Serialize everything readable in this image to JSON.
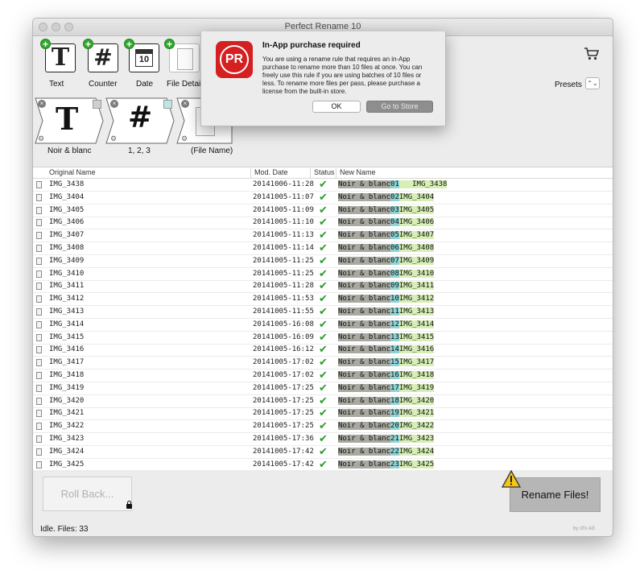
{
  "window": {
    "title": "Perfect Rename 10"
  },
  "toolbar": {
    "items": [
      {
        "label": "Text",
        "glyph": "T"
      },
      {
        "label": "Counter",
        "glyph": "#"
      },
      {
        "label": "Date",
        "glyph": "10"
      },
      {
        "label": "File Detail"
      }
    ],
    "presets_label": "Presets",
    "presets_arrows": "⌃⌄",
    "cart_icon": "cart-icon"
  },
  "rule_chips": [
    {
      "label": "Noir & blanc",
      "glyph": "T"
    },
    {
      "label": "1, 2, 3",
      "glyph": "#"
    },
    {
      "label": "(File Name)"
    }
  ],
  "table": {
    "headers": {
      "original": "Original Name",
      "date": "Mod. Date",
      "status": "Status",
      "new": "New Name"
    },
    "rows": [
      {
        "orig": "   IMG_3438",
        "date": "20141006-11:28",
        "n1": "Noir & blanc",
        "n2": "01",
        "n3": "   IMG_3438"
      },
      {
        "orig": "IMG_3404",
        "date": "20141005-11:07",
        "n1": "Noir & blanc",
        "n2": "02",
        "n3": "IMG_3404"
      },
      {
        "orig": "IMG_3405",
        "date": "20141005-11:09",
        "n1": "Noir & blanc",
        "n2": "03",
        "n3": "IMG_3405"
      },
      {
        "orig": "IMG_3406",
        "date": "20141005-11:10",
        "n1": "Noir & blanc",
        "n2": "04",
        "n3": "IMG_3406"
      },
      {
        "orig": "IMG_3407",
        "date": "20141005-11:13",
        "n1": "Noir & blanc",
        "n2": "05",
        "n3": "IMG_3407"
      },
      {
        "orig": "IMG_3408",
        "date": "20141005-11:14",
        "n1": "Noir & blanc",
        "n2": "06",
        "n3": "IMG_3408"
      },
      {
        "orig": "IMG_3409",
        "date": "20141005-11:25",
        "n1": "Noir & blanc",
        "n2": "07",
        "n3": "IMG_3409"
      },
      {
        "orig": "IMG_3410",
        "date": "20141005-11:25",
        "n1": "Noir & blanc",
        "n2": "08",
        "n3": "IMG_3410"
      },
      {
        "orig": "IMG_3411",
        "date": "20141005-11:28",
        "n1": "Noir & blanc",
        "n2": "09",
        "n3": "IMG_3411"
      },
      {
        "orig": "IMG_3412",
        "date": "20141005-11:53",
        "n1": "Noir & blanc",
        "n2": "10",
        "n3": "IMG_3412"
      },
      {
        "orig": "IMG_3413",
        "date": "20141005-11:55",
        "n1": "Noir & blanc",
        "n2": "11",
        "n3": "IMG_3413"
      },
      {
        "orig": "IMG_3414",
        "date": "20141005-16:08",
        "n1": "Noir & blanc",
        "n2": "12",
        "n3": "IMG_3414"
      },
      {
        "orig": "IMG_3415",
        "date": "20141005-16:09",
        "n1": "Noir & blanc",
        "n2": "13",
        "n3": "IMG_3415"
      },
      {
        "orig": "IMG_3416",
        "date": "20141005-16:12",
        "n1": "Noir & blanc",
        "n2": "14",
        "n3": "IMG_3416"
      },
      {
        "orig": "IMG_3417",
        "date": "20141005-17:02",
        "n1": "Noir & blanc",
        "n2": "15",
        "n3": "IMG_3417"
      },
      {
        "orig": "IMG_3418",
        "date": "20141005-17:02",
        "n1": "Noir & blanc",
        "n2": "16",
        "n3": "IMG_3418"
      },
      {
        "orig": "IMG_3419",
        "date": "20141005-17:25",
        "n1": "Noir & blanc",
        "n2": "17",
        "n3": "IMG_3419"
      },
      {
        "orig": "IMG_3420",
        "date": "20141005-17:25",
        "n1": "Noir & blanc",
        "n2": "18",
        "n3": "IMG_3420"
      },
      {
        "orig": "IMG_3421",
        "date": "20141005-17:25",
        "n1": "Noir & blanc",
        "n2": "19",
        "n3": "IMG_3421"
      },
      {
        "orig": "IMG_3422",
        "date": "20141005-17:25",
        "n1": "Noir & blanc",
        "n2": "20",
        "n3": "IMG_3422"
      },
      {
        "orig": "IMG_3423",
        "date": "20141005-17:36",
        "n1": "Noir & blanc",
        "n2": "21",
        "n3": "IMG_3423"
      },
      {
        "orig": "IMG_3424",
        "date": "20141005-17:42",
        "n1": "Noir & blanc",
        "n2": "22",
        "n3": "IMG_3424"
      },
      {
        "orig": "IMG_3425",
        "date": "20141005-17:42",
        "n1": "Noir & blanc",
        "n2": "23",
        "n3": "IMG_3425"
      }
    ]
  },
  "footer": {
    "rollback_label": "Roll Back...",
    "rename_label": "Rename Files!",
    "status_text": "Idle. Files: 33",
    "credit": "by cf/x AG"
  },
  "dialog": {
    "title": "In-App purchase required",
    "message": "You are using a rename rule that requires an in-App purchase to rename more than 10 files at once. You can freely use this rule if you are using batches of 10 files or less. To rename more files per pass, please purchase a license from the built-in store.",
    "ok_label": "OK",
    "store_label": "Go to Store",
    "icon_text": "PR"
  },
  "colors": {
    "accent_red": "#d42020",
    "check_green": "#2b9b2b",
    "seg_text": "#a9a9a1",
    "seg_counter": "#8fd3d3",
    "seg_name": "#d7efb6"
  }
}
